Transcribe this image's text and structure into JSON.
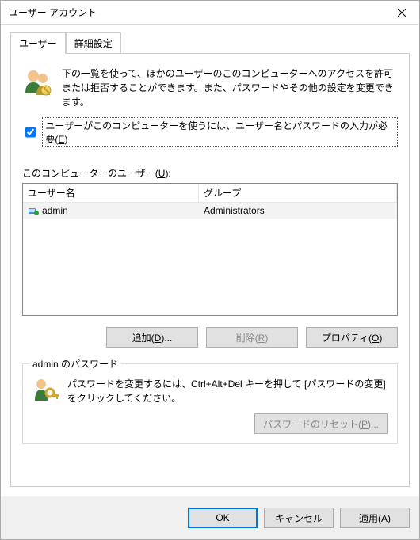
{
  "window": {
    "title": "ユーザー アカウント"
  },
  "tabs": {
    "users": "ユーザー",
    "advanced": "詳細設定"
  },
  "intro": "下の一覧を使って、ほかのユーザーのこのコンピューターへのアクセスを許可または拒否することができます。また、パスワードやその他の設定を変更できます。",
  "requireCredsLabel": "ユーザーがこのコンピューターを使うには、ユーザー名とパスワードの入力が必要(",
  "requireCredsKey": "E",
  "requireCredsClose": ")",
  "usersLabelPrefix": "このコンピューターのユーザー(",
  "usersLabelKey": "U",
  "usersLabelClose": "):",
  "columns": {
    "name": "ユーザー名",
    "group": "グループ"
  },
  "rows": [
    {
      "name": "admin",
      "group": "Administrators"
    }
  ],
  "buttons": {
    "addPrefix": "追加(",
    "addKey": "D",
    "addClose": ")...",
    "removePrefix": "削除(",
    "removeKey": "R",
    "removeClose": ")",
    "propsPrefix": "プロパティ(",
    "propsKey": "O",
    "propsClose": ")"
  },
  "passwordBox": {
    "title": "admin のパスワード",
    "text": "パスワードを変更するには、Ctrl+Alt+Del キーを押して [パスワードの変更] をクリックしてください。",
    "resetPrefix": "パスワードのリセット(",
    "resetKey": "P",
    "resetClose": ")..."
  },
  "footer": {
    "ok": "OK",
    "cancel": "キャンセル",
    "applyPrefix": "適用(",
    "applyKey": "A",
    "applyClose": ")"
  }
}
